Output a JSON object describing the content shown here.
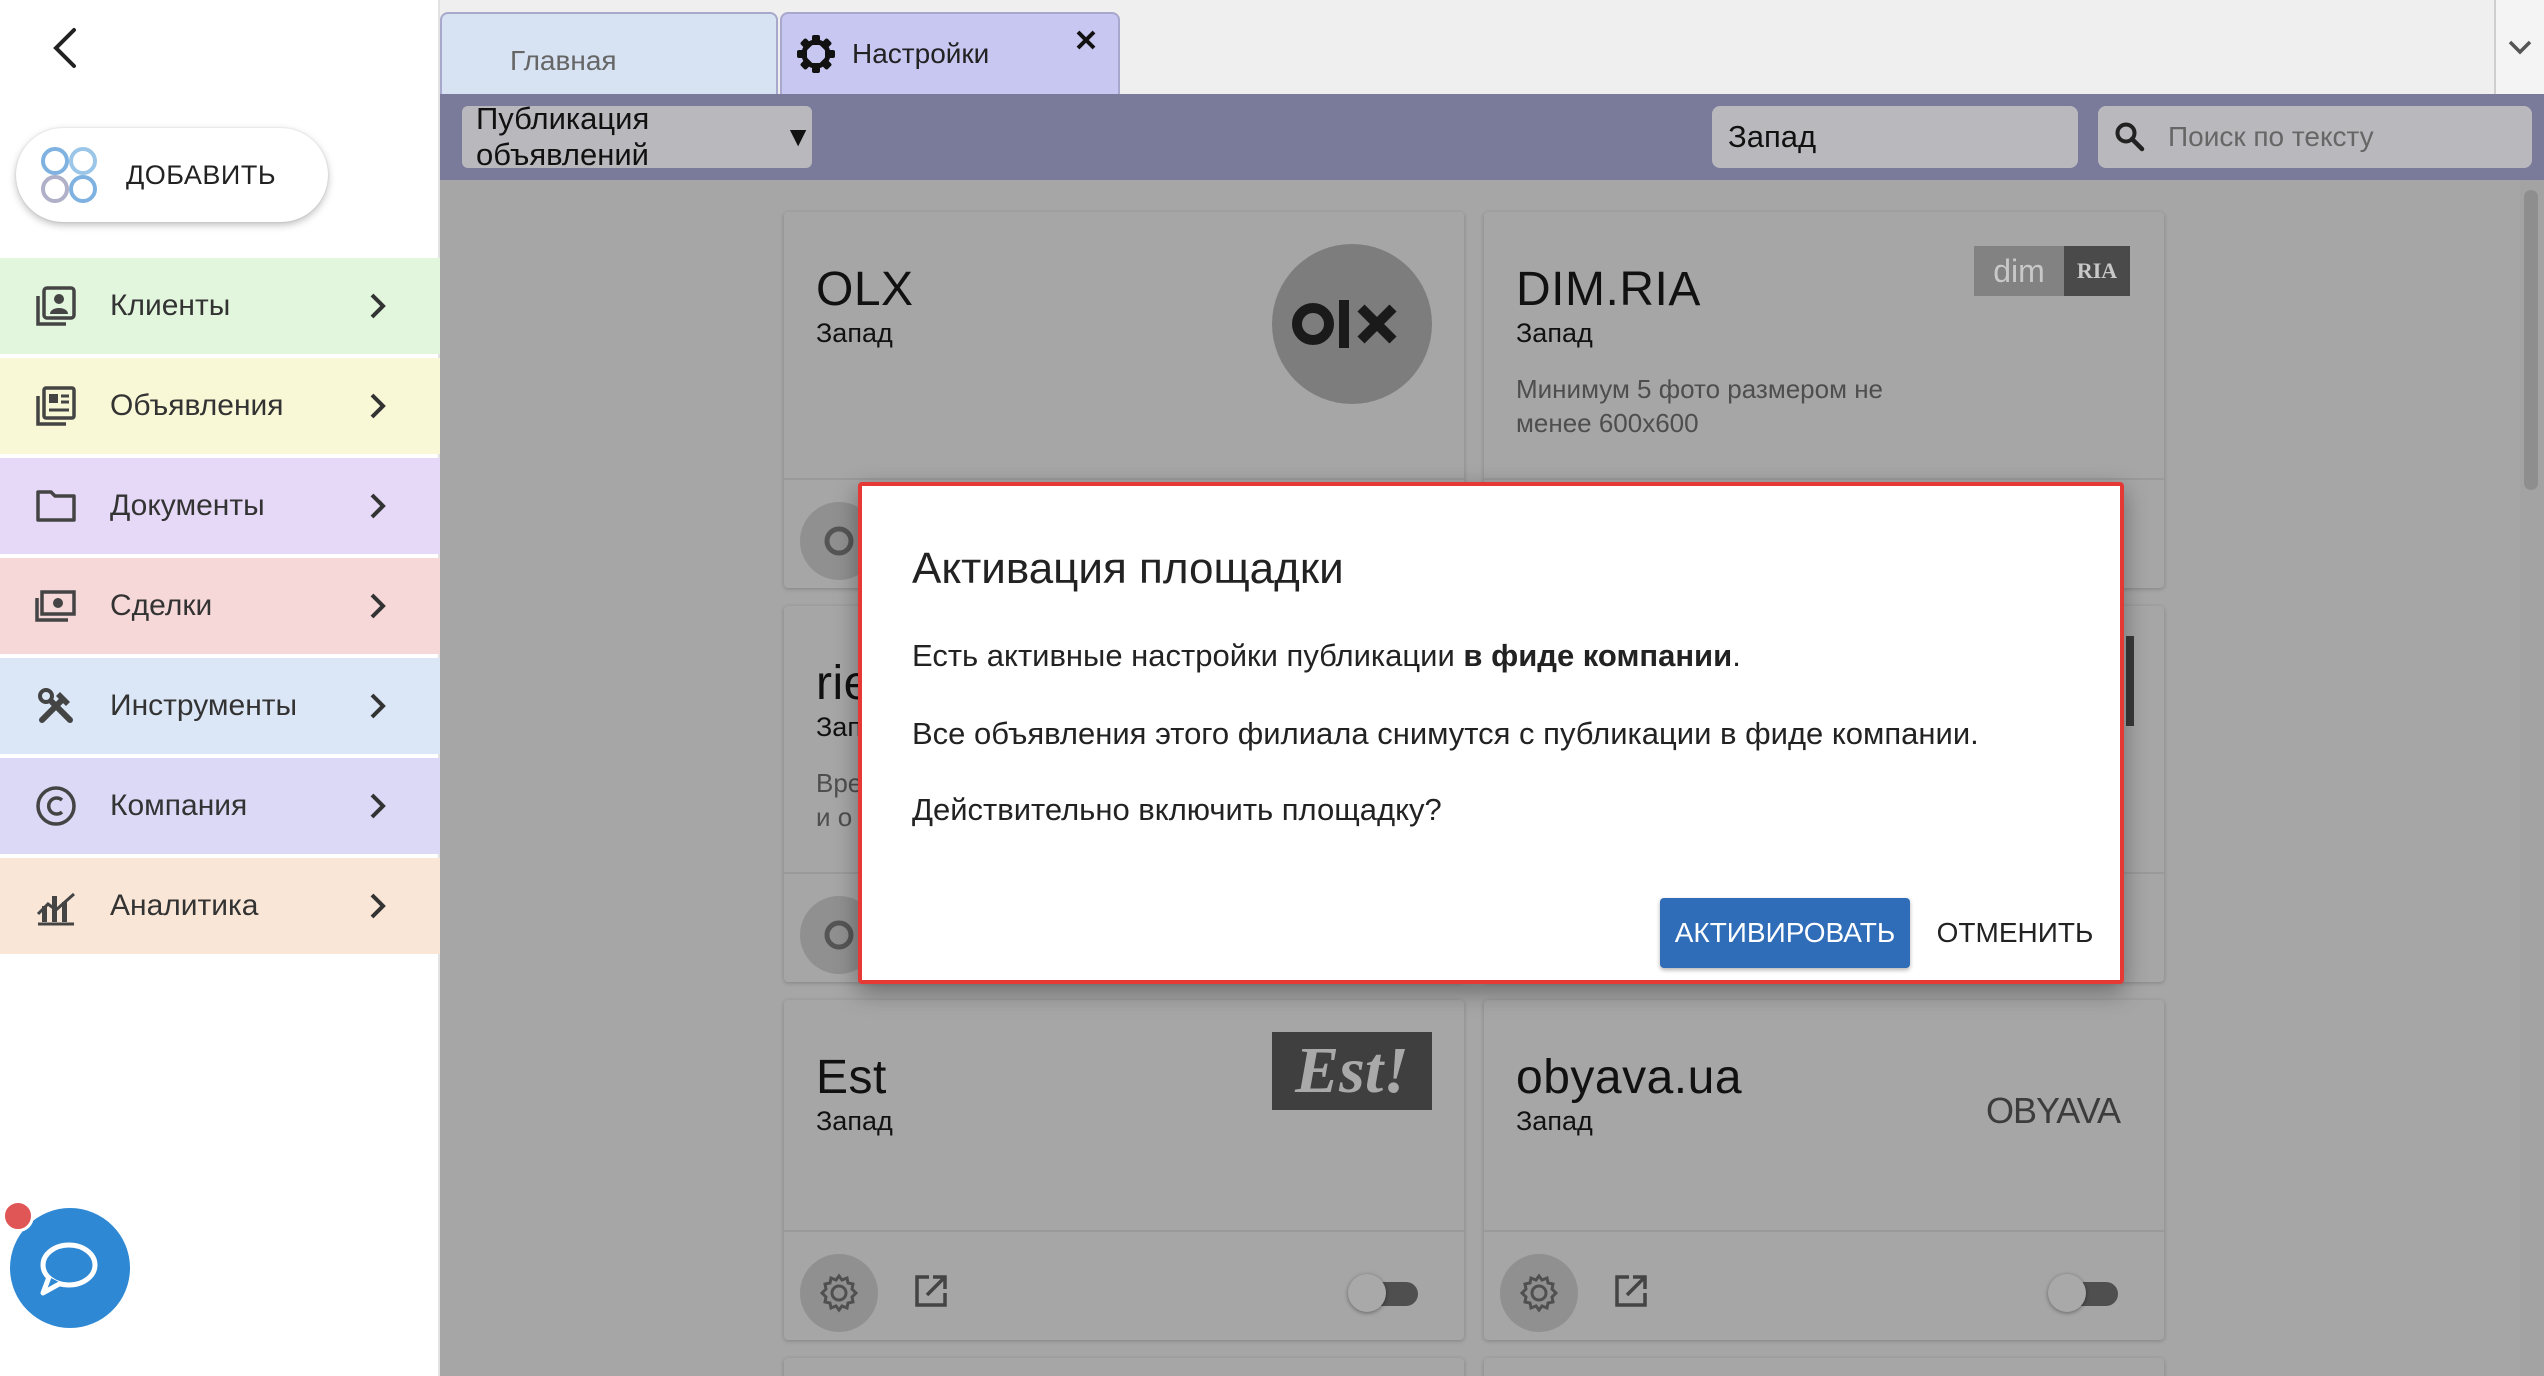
{
  "sidebar": {
    "add_label": "ДОБАВИТЬ",
    "items": [
      {
        "label": "Клиенты",
        "icon": "contacts-icon",
        "color": "#e2f6dd"
      },
      {
        "label": "Объявления",
        "icon": "listing-icon",
        "color": "#f9f8d6"
      },
      {
        "label": "Документы",
        "icon": "folder-icon",
        "color": "#e6d9f7"
      },
      {
        "label": "Сделки",
        "icon": "cash-icon",
        "color": "#f7d8d8"
      },
      {
        "label": "Инструменты",
        "icon": "tools-icon",
        "color": "#dbe7f6"
      },
      {
        "label": "Компания",
        "icon": "copyright-icon",
        "color": "#dcd9f6"
      },
      {
        "label": "Аналитика",
        "icon": "analytics-icon",
        "color": "#f9e6d6"
      }
    ]
  },
  "tabs": {
    "home": "Главная",
    "settings": "Настройки"
  },
  "toolbar": {
    "publication_select": "Публикация объявлений",
    "region_value": "Запад",
    "search_placeholder": "Поиск по тексту"
  },
  "cards": [
    {
      "title": "OLX",
      "region": "Запад",
      "description": "",
      "logo": "olx-logo"
    },
    {
      "title": "DIM.RIA",
      "region": "Запад",
      "description": "Минимум 5 фото размером не менее 600x600",
      "logo": "dimria-logo",
      "logo_text_a": "dim",
      "logo_text_b": "RIA"
    },
    {
      "title": "rie",
      "region": "Зап",
      "description": "Вре и о",
      "logo": ""
    },
    {
      "title": "",
      "region": "",
      "description": "",
      "logo": ""
    },
    {
      "title": "Est",
      "region": "Запад",
      "description": "",
      "logo": "est-logo",
      "logo_text": "Est!"
    },
    {
      "title": "obyava.ua",
      "region": "Запад",
      "description": "",
      "logo": "obyava-logo",
      "logo_text": "OBYAVA"
    }
  ],
  "dialog": {
    "title": "Активация площадки",
    "line1_prefix": "Есть активные настройки публикации ",
    "line1_bold": "в фиде компании",
    "line1_suffix": ".",
    "line2": "Все объявления этого филиала снимутся с публикации в фиде компании.",
    "line3": "Действительно включить площадку?",
    "activate_label": "АКТИВИРОВАТЬ",
    "cancel_label": "ОТМЕНИТЬ"
  },
  "colors": {
    "accent": "#2f6db8",
    "toolbar": "#7a7a9b",
    "dialog_border": "#e53935",
    "chat": "#2f88d4"
  }
}
